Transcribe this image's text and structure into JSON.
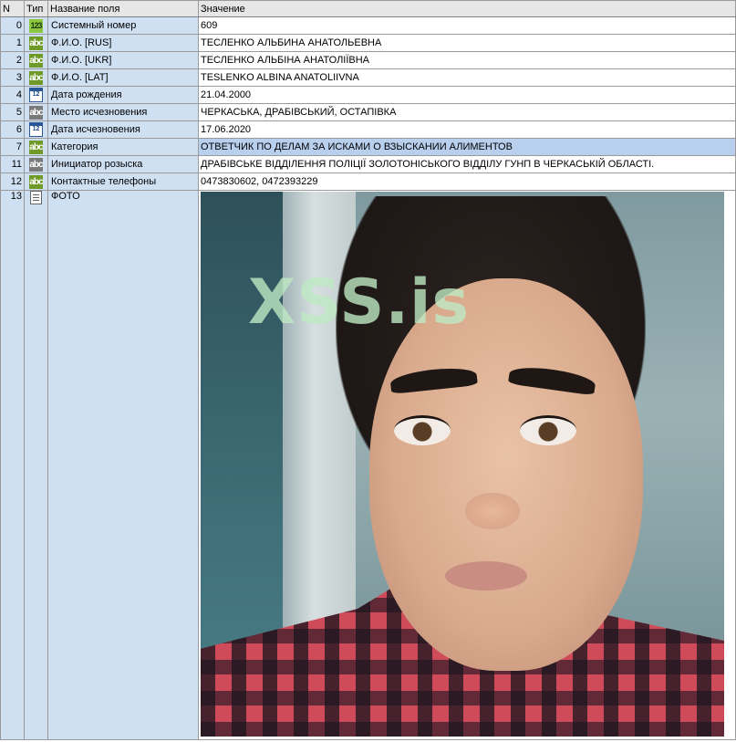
{
  "columns": {
    "n": "N",
    "type": "Тип",
    "field": "Название поля",
    "value": "Значение"
  },
  "rows": [
    {
      "n": "0",
      "type": "123",
      "field": "Системный номер",
      "value": "609"
    },
    {
      "n": "1",
      "type": "abc",
      "field": "Ф.И.О. [RUS]",
      "value": "ТЕСЛЕНКО АЛЬБИНА АНАТОЛЬЕВНА"
    },
    {
      "n": "2",
      "type": "abc",
      "field": "Ф.И.О. [UKR]",
      "value": "ТЕСЛЕНКО АЛЬБІНА АНАТОЛІЇВНА"
    },
    {
      "n": "3",
      "type": "abc",
      "field": "Ф.И.О. [LAT]",
      "value": "TESLENKO ALBINA ANATOLIIVNA"
    },
    {
      "n": "4",
      "type": "12",
      "field": "Дата рождения",
      "value": "21.04.2000"
    },
    {
      "n": "5",
      "type": "abc",
      "field": "Место исчезновения",
      "value": "ЧЕРКАСЬКА, ДРАБІВСЬКИЙ, ОСТАПІВКА"
    },
    {
      "n": "6",
      "type": "12",
      "field": "Дата исчезновения",
      "value": "17.06.2020"
    },
    {
      "n": "7",
      "type": "abc",
      "field": "Категория",
      "value": "ОТВЕТЧИК ПО ДЕЛАМ ЗА ИСКАМИ О ВЗЫСКАНИИ АЛИМЕНТОВ"
    },
    {
      "n": "11",
      "type": "abc",
      "field": "Инициатор розыска",
      "value": "ДРАБІВСЬКЕ ВІДДІЛЕННЯ ПОЛІЦІЇ ЗОЛОТОНІСЬКОГО ВІДДІЛУ ГУНП В ЧЕРКАСЬКІЙ ОБЛАСТІ."
    },
    {
      "n": "12",
      "type": "abc",
      "field": "Контактные телефоны",
      "value": "0473830602, 0472393229"
    },
    {
      "n": "13",
      "type": "",
      "field": "ФОТО",
      "value": ""
    }
  ],
  "photo": {
    "watermark": "XSS.is"
  },
  "icons": {
    "number": "number-type-icon",
    "text": "text-type-icon",
    "date": "calendar-type-icon",
    "file": "document-type-icon"
  },
  "colors": {
    "key_column_bg": "#cfe0f3",
    "selected_row_bg": "#b9cfee",
    "header_bg": "#e6e6e6",
    "grid_line": "#9a9a9a"
  }
}
